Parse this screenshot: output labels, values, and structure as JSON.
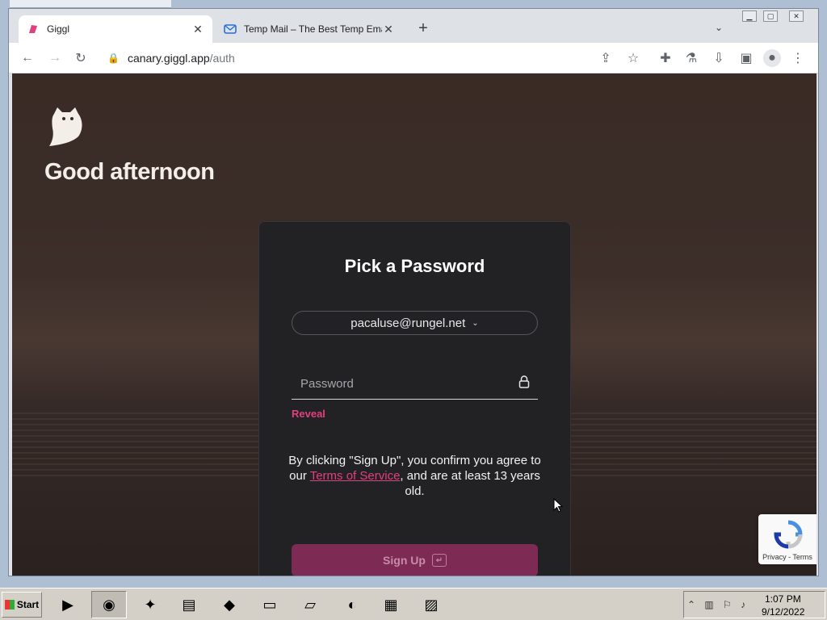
{
  "browser": {
    "tabs": [
      {
        "title": "Giggl",
        "active": true
      },
      {
        "title": "Temp Mail – The Best Temp Email",
        "active": false
      }
    ],
    "new_tab_icon": "plus-icon",
    "url_host": "canary.giggl.app",
    "url_path": "/auth"
  },
  "page": {
    "greeting": "Good afternoon",
    "card_title": "Pick a Password",
    "account_email": "pacaluse@rungel.net",
    "password_placeholder": "Password",
    "reveal_label": "Reveal",
    "terms_before": "By clicking \"Sign Up\", you confirm you agree to our ",
    "terms_link": "Terms of Service",
    "terms_after": ", and are at least 13 years old.",
    "signup_label": "Sign Up",
    "recaptcha_links": "Privacy - Terms"
  },
  "colors": {
    "accent": "#e0407e",
    "signup_bg": "#7d2a54",
    "card_bg": "#222224"
  },
  "taskbar": {
    "start_label": "Start",
    "time": "1:07 PM",
    "date": "9/12/2022"
  }
}
